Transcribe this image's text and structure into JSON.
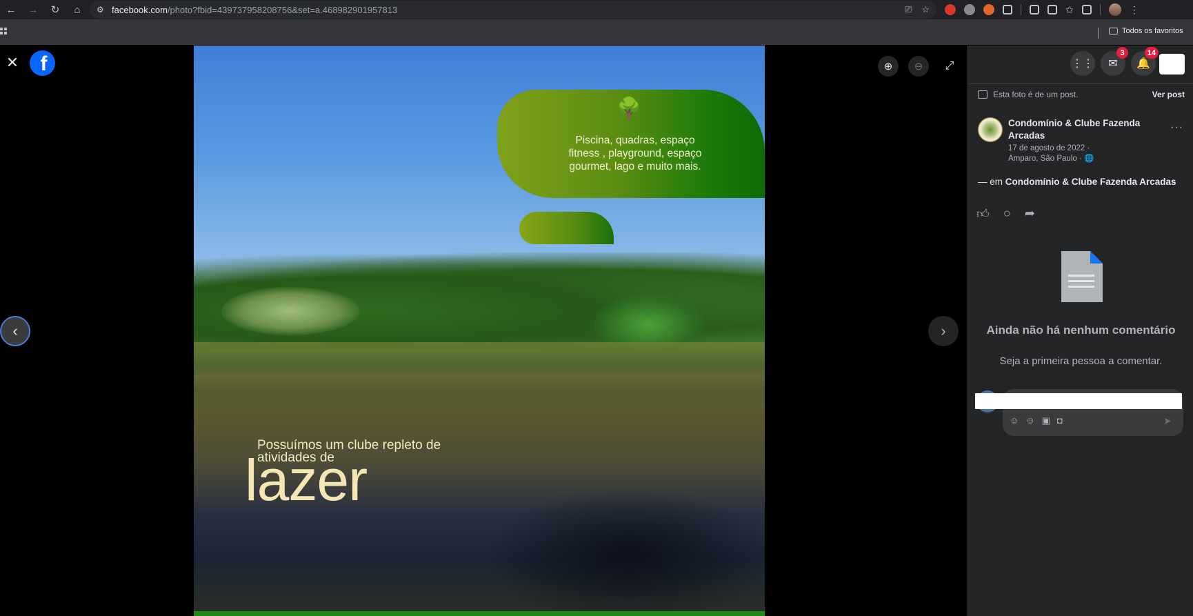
{
  "browser": {
    "url_domain": "facebook.com",
    "url_path": "/photo?fbid=439737958208756&set=a.468982901957813",
    "bookmark_folder": "Todos os favoritos"
  },
  "photo": {
    "banner_lines": [
      "Piscina, quadras, espaço",
      "fitness , playground, espaço",
      "gourmet, lago e muito mais."
    ],
    "slogan_line1": "Possuímos um clube repleto de",
    "slogan_line2": "atividades de",
    "slogan_big": "lazer"
  },
  "panel": {
    "messenger_badge": "3",
    "notifications_badge": "14",
    "post_note": "Esta foto é de um post.",
    "view_post": "Ver post",
    "page_name": "Condomínio & Clube Fazenda Arcadas",
    "post_date": "17 de agosto de 2022 ·",
    "post_location": "Amparo, São Paulo ·",
    "tag_prefix": "— em",
    "tag_name": "Condomínio & Clube Fazenda Arcadas",
    "no_comments_title": "Ainda não há nenhum comentário",
    "no_comments_sub": "Seja a primeira pessoa a comentar."
  },
  "colors": {
    "fb_blue": "#0866ff",
    "badge_red": "#e41e3f",
    "panel_bg": "#242526"
  },
  "icons": [
    "back-icon",
    "forward-icon",
    "reload-icon",
    "home-icon",
    "site-info-icon",
    "install-icon",
    "star-icon",
    "close-icon",
    "facebook-logo",
    "zoom-in-icon",
    "zoom-out-icon",
    "fullscreen-icon",
    "chevron-left-icon",
    "chevron-right-icon",
    "menu-grid-icon",
    "messenger-icon",
    "bell-icon",
    "like-icon",
    "comment-icon",
    "share-icon",
    "document-icon",
    "send-icon"
  ]
}
